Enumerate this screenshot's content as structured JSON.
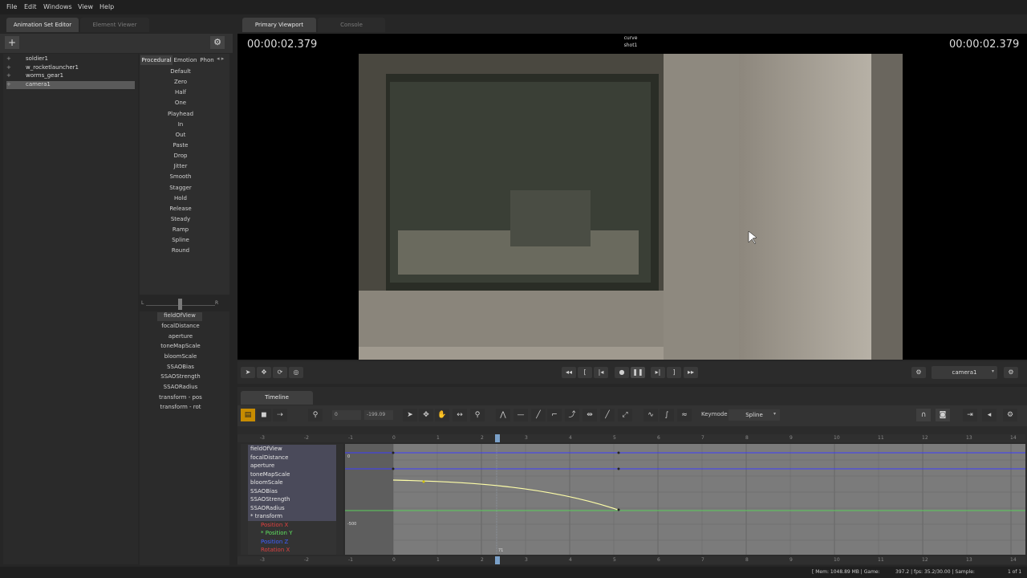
{
  "menu": [
    "File",
    "Edit",
    "Windows",
    "View",
    "Help"
  ],
  "left_tabs": [
    "Animation Set Editor",
    "Element Viewer"
  ],
  "tree": [
    {
      "label": "soldier1",
      "selected": false
    },
    {
      "label": "w_rocketlauncher1",
      "selected": false
    },
    {
      "label": "worms_gear1",
      "selected": false
    },
    {
      "label": "camera1",
      "selected": true
    }
  ],
  "preset_tabs": [
    "Procedural",
    "Emotion",
    "Phon"
  ],
  "presets": [
    "Default",
    "Zero",
    "Half",
    "One",
    "Playhead",
    "In",
    "Out",
    "Paste",
    "Drop",
    "Jitter",
    "Smooth",
    "Stagger",
    "Hold",
    "Release",
    "Steady",
    "Ramp",
    "Spline",
    "Round"
  ],
  "slider": {
    "left": "L",
    "right": "R"
  },
  "attributes": [
    "fieldOfView",
    "focalDistance",
    "aperture",
    "toneMapScale",
    "bloomScale",
    "SSAOBias",
    "SSAOStrength",
    "SSAORadius",
    "transform - pos",
    "transform - rot"
  ],
  "viewport_tabs": [
    "Primary Viewport",
    "Console"
  ],
  "viewport": {
    "timecode_left": "00:00:02.379",
    "timecode_right": "00:00:02.379",
    "center_line1": "curve",
    "center_line2": "shot1",
    "camera": "camera1"
  },
  "timeline": {
    "tab": "Timeline",
    "field_start": "0",
    "field_end": "-199.09",
    "keymode_label": "Keymode",
    "keymode_value": "Spline",
    "playhead_label": "71",
    "value_top": "0",
    "value_bottom": "-500",
    "ruler_ticks": [
      "-3",
      "-2",
      "-1",
      "0",
      "1",
      "2",
      "3",
      "4",
      "5",
      "6",
      "7",
      "8",
      "9",
      "10",
      "11",
      "12",
      "13",
      "14"
    ],
    "channels": [
      {
        "label": "fieldOfView",
        "color": "#e6e6e6"
      },
      {
        "label": "focalDistance",
        "color": "#e6e6e6"
      },
      {
        "label": "aperture",
        "color": "#e6e6e6"
      },
      {
        "label": "toneMapScale",
        "color": "#e6e6e6"
      },
      {
        "label": "bloomScale",
        "color": "#e6e6e6"
      },
      {
        "label": "SSAOBias",
        "color": "#e6e6e6"
      },
      {
        "label": "SSAOStrength",
        "color": "#e6e6e6"
      },
      {
        "label": "SSAORadius",
        "color": "#e6e6e6"
      },
      {
        "label": "* transform",
        "color": "#e6e6e6"
      },
      {
        "label": "Position X",
        "color": "#e04040"
      },
      {
        "label": "* Position Y",
        "color": "#60e060"
      },
      {
        "label": "Position Z",
        "color": "#4060ff"
      },
      {
        "label": "Rotation X",
        "color": "#e04040"
      }
    ]
  },
  "status": {
    "mem": "[ Mem: 1048.89 MB | Game:",
    "fps": "397.2 | fps:  35.2/30.00 | Sample:",
    "page": "1 of 1"
  },
  "colors": {
    "accent": "#f0b000",
    "selection": "#5a5a5a"
  }
}
